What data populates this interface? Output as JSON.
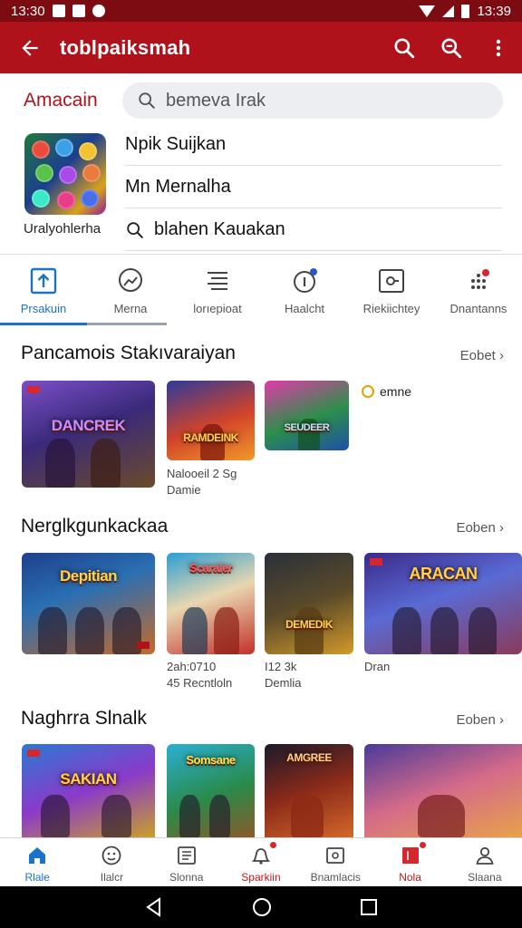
{
  "status_bar": {
    "time_left": "13:30",
    "time_right": "13:39"
  },
  "app_bar": {
    "title": "toblpaiksmah",
    "icons": [
      "back-arrow-icon",
      "search-icon",
      "search-icon",
      "more-vert-icon"
    ]
  },
  "top": {
    "brand": "Amacain",
    "search_placeholder": "bemeva Irak",
    "app_name": "Uralyohlerha",
    "rows": [
      "Npik Suijkan",
      "Mn Mernalha",
      "blahen Kauakan"
    ]
  },
  "tabs": [
    {
      "label": "Prsakuin",
      "icon": "upload-icon"
    },
    {
      "label": "Merna",
      "icon": "chat-icon"
    },
    {
      "label": "lorıepioat",
      "icon": "list-icon"
    },
    {
      "label": "Haalcht",
      "icon": "info-icon"
    },
    {
      "label": "Riekiichtey",
      "icon": "screen-icon"
    },
    {
      "label": "Dnantanns",
      "icon": "dots-icon"
    }
  ],
  "colors": {
    "header": "#b0121c",
    "status_bar": "#7d0c12",
    "accent": "#1a73c9",
    "alert": "#d7262c"
  },
  "sections": [
    {
      "title": "Pancamois Stakıvaraiyan",
      "see_all": "Eobet",
      "tiles": [
        {
          "logo": "DANCREK",
          "caption": []
        },
        {
          "logo": "RAMDEINK",
          "caption": [
            "Nalooeil 2 Sg",
            "Damie"
          ]
        },
        {
          "logo": "SEUDEER",
          "caption": []
        }
      ],
      "chip": "emne"
    },
    {
      "title": "Nerglkgunkackaa",
      "see_all": "Eoben",
      "tiles": [
        {
          "logo": "Depitian",
          "caption": []
        },
        {
          "logo": "Scaraler",
          "caption": [
            "2ah:0710",
            "45 Recntloln"
          ]
        },
        {
          "logo": "DEMEDIK",
          "caption": [
            "I12 3k",
            "Demlia"
          ]
        },
        {
          "logo": "ARACAN",
          "caption": [
            "Dran"
          ]
        }
      ]
    },
    {
      "title": "Naghrra Slnalk",
      "see_all": "Eoben",
      "tiles": [
        {
          "logo": "SAKIAN",
          "caption": []
        },
        {
          "logo": "Somsane",
          "caption": []
        },
        {
          "logo": "AMGREE",
          "caption": []
        },
        {
          "logo": "",
          "caption": []
        }
      ]
    }
  ],
  "bottom_nav": [
    {
      "label": "Rlale",
      "icon": "home-icon"
    },
    {
      "label": "Ilalcr",
      "icon": "face-icon"
    },
    {
      "label": "Slonna",
      "icon": "document-icon"
    },
    {
      "label": "Sparkiin",
      "icon": "bell-icon"
    },
    {
      "label": "Bnamlacis",
      "icon": "photo-icon"
    },
    {
      "label": "Nola",
      "icon": "bookmark-icon"
    },
    {
      "label": "Slaana",
      "icon": "person-icon"
    }
  ],
  "system_nav": [
    "back-triangle-icon",
    "home-circle-icon",
    "recents-square-icon"
  ]
}
